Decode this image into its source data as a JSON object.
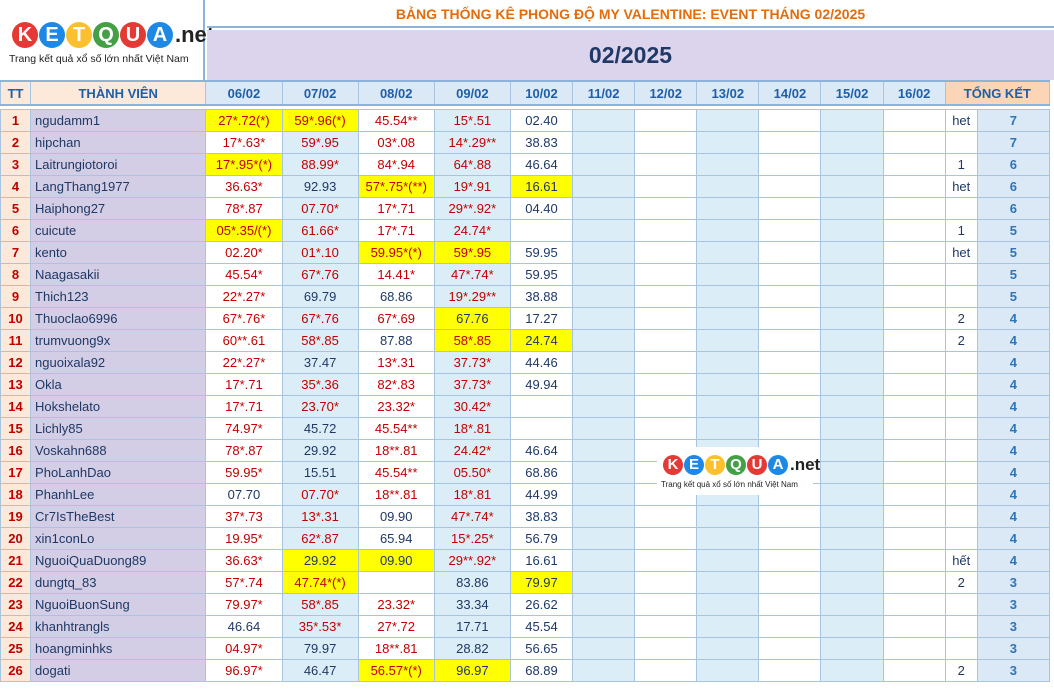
{
  "logo": {
    "letters": [
      "K",
      "E",
      "T",
      "Q",
      "U",
      "A"
    ],
    "colors": [
      "#e53935",
      "#1e88e5",
      "#fbc02d",
      "#43a047",
      "#e53935",
      "#1e88e5"
    ],
    "suffix": ".net",
    "tagline": "Trang kết quả xổ số lớn nhất Việt Nam"
  },
  "title": "BẢNG THỐNG KÊ PHONG ĐỘ MY VALENTINE: EVENT THÁNG 02/2025",
  "month": "02/2025",
  "header": {
    "tt": "TT",
    "member": "THÀNH VIÊN",
    "days": [
      "06/02",
      "07/02",
      "08/02",
      "09/02",
      "10/02",
      "11/02",
      "12/02",
      "13/02",
      "14/02",
      "15/02",
      "16/02"
    ],
    "total": "TỔNG KẾT"
  },
  "rows": [
    {
      "tt": "1",
      "name": "ngudamm1",
      "cells": [
        [
          "27*.72(*)",
          "hl"
        ],
        [
          "59*.96(*)",
          "hl"
        ],
        [
          "45.54**",
          ""
        ],
        [
          "15*.51",
          ""
        ],
        [
          "02.40",
          "blue"
        ]
      ],
      "note": "het",
      "score": "7"
    },
    {
      "tt": "2",
      "name": "hipchan",
      "cells": [
        [
          "17*.63*",
          ""
        ],
        [
          "59*.95",
          ""
        ],
        [
          "03*.08",
          ""
        ],
        [
          "14*.29**",
          ""
        ],
        [
          "38.83",
          "blue"
        ]
      ],
      "note": "",
      "score": "7"
    },
    {
      "tt": "3",
      "name": "Laitrungiotoroi",
      "cells": [
        [
          "17*.95*(*)",
          "hl"
        ],
        [
          "88.99*",
          ""
        ],
        [
          "84*.94",
          ""
        ],
        [
          "64*.88",
          ""
        ],
        [
          "46.64",
          "blue"
        ]
      ],
      "note": "1",
      "score": "6"
    },
    {
      "tt": "4",
      "name": "LangThang1977",
      "cells": [
        [
          "36.63*",
          ""
        ],
        [
          "92.93",
          "blue"
        ],
        [
          "57*.75*(**)",
          "hl"
        ],
        [
          "19*.91",
          ""
        ],
        [
          "16.61",
          "hl blue"
        ]
      ],
      "note": "het",
      "score": "6"
    },
    {
      "tt": "5",
      "name": "Haiphong27",
      "cells": [
        [
          "78*.87",
          ""
        ],
        [
          "07.70*",
          ""
        ],
        [
          "17*.71",
          ""
        ],
        [
          "29**.92*",
          ""
        ],
        [
          "04.40",
          "blue"
        ]
      ],
      "note": "",
      "score": "6"
    },
    {
      "tt": "6",
      "name": "cuicute",
      "cells": [
        [
          "05*.35/(*)",
          "hl"
        ],
        [
          "61.66*",
          ""
        ],
        [
          "17*.71",
          ""
        ],
        [
          "24.74*",
          ""
        ],
        [
          "",
          ""
        ]
      ],
      "note": "1",
      "score": "5"
    },
    {
      "tt": "7",
      "name": "kento",
      "cells": [
        [
          "02.20*",
          ""
        ],
        [
          "01*.10",
          ""
        ],
        [
          "59.95*(*)",
          "hl"
        ],
        [
          "59*.95",
          "hl"
        ],
        [
          "59.95",
          "blue"
        ]
      ],
      "note": "het",
      "score": "5"
    },
    {
      "tt": "8",
      "name": "Naagasakii",
      "cells": [
        [
          "45.54*",
          ""
        ],
        [
          "67*.76",
          ""
        ],
        [
          "14.41*",
          ""
        ],
        [
          "47*.74*",
          ""
        ],
        [
          "59.95",
          "blue"
        ]
      ],
      "note": "",
      "score": "5"
    },
    {
      "tt": "9",
      "name": "Thich123",
      "cells": [
        [
          "22*.27*",
          ""
        ],
        [
          "69.79",
          "blue"
        ],
        [
          "68.86",
          "blue"
        ],
        [
          "19*.29**",
          ""
        ],
        [
          "38.88",
          "blue"
        ]
      ],
      "note": "",
      "score": "5"
    },
    {
      "tt": "10",
      "name": "Thuoclao6996",
      "cells": [
        [
          "67*.76*",
          ""
        ],
        [
          "67*.76",
          ""
        ],
        [
          "67*.69",
          ""
        ],
        [
          "67.76",
          "hl blue"
        ],
        [
          "17.27",
          "blue"
        ]
      ],
      "note": "2",
      "score": "4"
    },
    {
      "tt": "11",
      "name": "trumvuong9x",
      "cells": [
        [
          "60**.61",
          ""
        ],
        [
          "58*.85",
          ""
        ],
        [
          "87.88",
          "blue"
        ],
        [
          "58*.85",
          "hl"
        ],
        [
          "24.74",
          "hl blue"
        ]
      ],
      "note": "2",
      "score": "4"
    },
    {
      "tt": "12",
      "name": "nguoixala92",
      "cells": [
        [
          "22*.27*",
          ""
        ],
        [
          "37.47",
          "blue"
        ],
        [
          "13*.31",
          ""
        ],
        [
          "37.73*",
          ""
        ],
        [
          "44.46",
          "blue"
        ]
      ],
      "note": "",
      "score": "4"
    },
    {
      "tt": "13",
      "name": "Okla",
      "cells": [
        [
          "17*.71",
          ""
        ],
        [
          "35*.36",
          ""
        ],
        [
          "82*.83",
          ""
        ],
        [
          "37.73*",
          ""
        ],
        [
          "49.94",
          "blue"
        ]
      ],
      "note": "",
      "score": "4"
    },
    {
      "tt": "14",
      "name": "Hokshelato",
      "cells": [
        [
          "17*.71",
          ""
        ],
        [
          "23.70*",
          ""
        ],
        [
          "23.32*",
          ""
        ],
        [
          "30.42*",
          ""
        ],
        [
          "",
          ""
        ]
      ],
      "note": "",
      "score": "4"
    },
    {
      "tt": "15",
      "name": "Lichly85",
      "cells": [
        [
          "74.97*",
          ""
        ],
        [
          "45.72",
          "blue"
        ],
        [
          "45.54**",
          ""
        ],
        [
          "18*.81",
          ""
        ],
        [
          "",
          ""
        ]
      ],
      "note": "",
      "score": "4"
    },
    {
      "tt": "16",
      "name": "Voskahn688",
      "cells": [
        [
          "78*.87",
          ""
        ],
        [
          "29.92",
          "blue"
        ],
        [
          "18**.81",
          ""
        ],
        [
          "24.42*",
          ""
        ],
        [
          "46.64",
          "blue"
        ]
      ],
      "note": "",
      "score": "4"
    },
    {
      "tt": "17",
      "name": "PhoLanhDao",
      "cells": [
        [
          "59.95*",
          ""
        ],
        [
          "15.51",
          "blue"
        ],
        [
          "45.54**",
          ""
        ],
        [
          "05.50*",
          ""
        ],
        [
          "68.86",
          "blue"
        ]
      ],
      "note": "",
      "score": "4"
    },
    {
      "tt": "18",
      "name": "PhanhLee",
      "cells": [
        [
          "07.70",
          "blue"
        ],
        [
          "07.70*",
          ""
        ],
        [
          "18**.81",
          ""
        ],
        [
          "18*.81",
          ""
        ],
        [
          "44.99",
          "blue"
        ]
      ],
      "note": "",
      "score": "4"
    },
    {
      "tt": "19",
      "name": "Cr7IsTheBest",
      "cells": [
        [
          "37*.73",
          ""
        ],
        [
          "13*.31",
          ""
        ],
        [
          "09.90",
          "blue"
        ],
        [
          "47*.74*",
          ""
        ],
        [
          "38.83",
          "blue"
        ]
      ],
      "note": "",
      "score": "4"
    },
    {
      "tt": "20",
      "name": "xin1conLo",
      "cells": [
        [
          "19.95*",
          ""
        ],
        [
          "62*.87",
          ""
        ],
        [
          "65.94",
          "blue"
        ],
        [
          "15*.25*",
          ""
        ],
        [
          "56.79",
          "blue"
        ]
      ],
      "note": "",
      "score": "4"
    },
    {
      "tt": "21",
      "name": "NguoiQuaDuong89",
      "cells": [
        [
          "36.63*",
          ""
        ],
        [
          "29.92",
          "hl blue"
        ],
        [
          "09.90",
          "hl blue"
        ],
        [
          "29**.92*",
          ""
        ],
        [
          "16.61",
          "blue"
        ]
      ],
      "note": "hết",
      "score": "4"
    },
    {
      "tt": "22",
      "name": "dungtq_83",
      "cells": [
        [
          "57*.74",
          ""
        ],
        [
          "47.74*(*)",
          "hl"
        ],
        [
          "",
          ""
        ],
        [
          "83.86",
          "blue"
        ],
        [
          "79.97",
          "hl blue"
        ]
      ],
      "note": "2",
      "score": "3"
    },
    {
      "tt": "23",
      "name": "NguoiBuonSung",
      "cells": [
        [
          "79.97*",
          ""
        ],
        [
          "58*.85",
          ""
        ],
        [
          "23.32*",
          ""
        ],
        [
          "33.34",
          "blue"
        ],
        [
          "26.62",
          "blue"
        ]
      ],
      "note": "",
      "score": "3"
    },
    {
      "tt": "24",
      "name": "khanhtrangls",
      "cells": [
        [
          "46.64",
          "blue"
        ],
        [
          "35*.53*",
          ""
        ],
        [
          "27*.72",
          ""
        ],
        [
          "17.71",
          "blue"
        ],
        [
          "45.54",
          "blue"
        ]
      ],
      "note": "",
      "score": "3"
    },
    {
      "tt": "25",
      "name": "hoangminhks",
      "cells": [
        [
          "04.97*",
          ""
        ],
        [
          "79.97",
          "blue"
        ],
        [
          "18**.81",
          ""
        ],
        [
          "28.82",
          "blue"
        ],
        [
          "56.65",
          "blue"
        ]
      ],
      "note": "",
      "score": "3"
    },
    {
      "tt": "26",
      "name": "dogati",
      "cells": [
        [
          "96.97*",
          ""
        ],
        [
          "46.47",
          "blue"
        ],
        [
          "56.57*(*)",
          "hl"
        ],
        [
          "96.97",
          "hl blue"
        ],
        [
          "68.89",
          "blue"
        ]
      ],
      "note": "2",
      "score": "3"
    }
  ],
  "watermark": {
    "letters": [
      "K",
      "E",
      "T",
      "Q",
      "U",
      "A"
    ],
    "suffix": ".net",
    "tagline": "Trang kết quả xổ số lớn nhất Việt Nam"
  }
}
